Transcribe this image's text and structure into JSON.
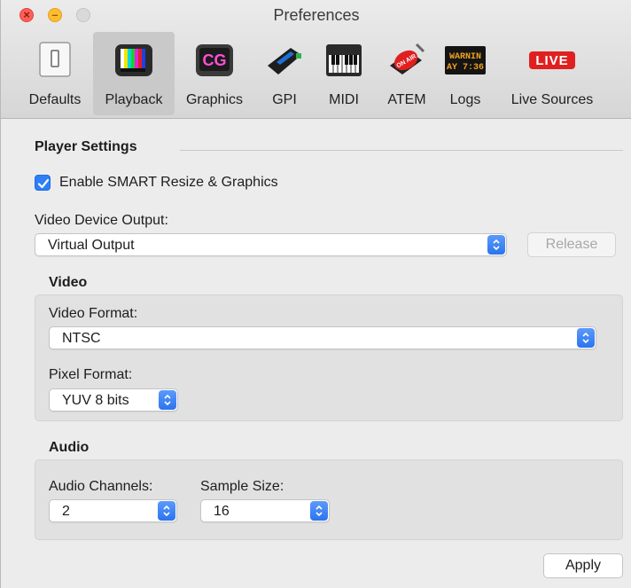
{
  "window": {
    "title": "Preferences"
  },
  "toolbar": {
    "items": [
      {
        "label": "Defaults",
        "icon": "switch-icon"
      },
      {
        "label": "Playback",
        "icon": "tv-color-bars-icon"
      },
      {
        "label": "Graphics",
        "icon": "cg-graphics-icon"
      },
      {
        "label": "GPI",
        "icon": "gpi-device-icon"
      },
      {
        "label": "MIDI",
        "icon": "piano-keyboard-icon"
      },
      {
        "label": "ATEM",
        "icon": "on-air-button-icon"
      },
      {
        "label": "Logs",
        "icon": "log-display-icon"
      },
      {
        "label": "Live Sources",
        "icon": "live-badge-icon"
      }
    ],
    "selected": "Playback",
    "logs_icon_text_line1": "WARNIN",
    "logs_icon_text_line2": "AY 7:36",
    "live_icon_text": "LIVE"
  },
  "player_settings": {
    "title": "Player Settings",
    "smart_resize_label": "Enable SMART Resize & Graphics",
    "smart_resize_checked": true,
    "video_device_output_label": "Video Device Output:",
    "video_device_output_value": "Virtual Output",
    "release_label": "Release"
  },
  "video": {
    "title": "Video",
    "format_label": "Video Format:",
    "format_value": "NTSC",
    "pixel_format_label": "Pixel Format:",
    "pixel_format_value": "YUV 8 bits"
  },
  "audio": {
    "title": "Audio",
    "channels_label": "Audio Channels:",
    "channels_value": "2",
    "sample_size_label": "Sample Size:",
    "sample_size_value": "16"
  },
  "footer": {
    "apply_label": "Apply"
  },
  "colors": {
    "accent": "#2f7ff6",
    "live_red": "#e02020",
    "window_bg": "#ececec"
  }
}
